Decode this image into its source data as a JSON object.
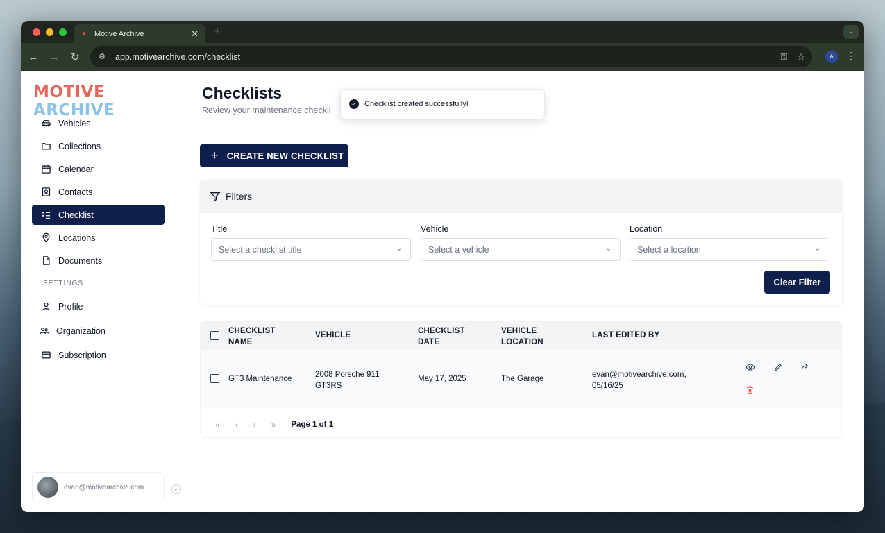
{
  "browser": {
    "tab_title": "Motive Archive",
    "url": "app.motivearchive.com/checklist",
    "profile_initial": "A"
  },
  "sidebar": {
    "logo_part1": "MOTIVE",
    "logo_part2": "ARCHIVE",
    "items": [
      {
        "label": "Vehicles",
        "icon": "car-icon"
      },
      {
        "label": "Collections",
        "icon": "folder-icon"
      },
      {
        "label": "Calendar",
        "icon": "calendar-icon"
      },
      {
        "label": "Contacts",
        "icon": "contact-card-icon"
      },
      {
        "label": "Checklist",
        "icon": "checklist-icon",
        "active": true
      },
      {
        "label": "Locations",
        "icon": "map-pin-icon"
      },
      {
        "label": "Documents",
        "icon": "documents-icon"
      }
    ],
    "settings_label": "SETTINGS",
    "settings_items": [
      {
        "label": "Profile",
        "icon": "user-icon"
      },
      {
        "label": "Organization",
        "icon": "users-icon"
      },
      {
        "label": "Subscription",
        "icon": "credit-card-icon"
      }
    ],
    "user_email": "evan@motivearchive.com"
  },
  "main": {
    "title": "Checklists",
    "subtitle": "Review your maintenance checkli",
    "toast": "Checklist created successfully!",
    "create_button": "CREATE NEW CHECKLIST",
    "filters": {
      "heading": "Filters",
      "title_label": "Title",
      "title_placeholder": "Select a checklist title",
      "vehicle_label": "Vehicle",
      "vehicle_placeholder": "Select a vehicle",
      "location_label": "Location",
      "location_placeholder": "Select a location",
      "clear_button": "Clear Filter"
    },
    "table": {
      "columns": {
        "name_1": "CHECKLIST",
        "name_2": "NAME",
        "vehicle": "VEHICLE",
        "date_1": "CHECKLIST",
        "date_2": "DATE",
        "loc_1": "VEHICLE",
        "loc_2": "LOCATION",
        "edited": "LAST EDITED BY"
      },
      "rows": [
        {
          "name": "GT3 Maintenance",
          "vehicle_1": "2008 Porsche 911",
          "vehicle_2": "GT3RS",
          "date": "May 17, 2025",
          "location": "The Garage",
          "edited_1": "evan@motivearchive.com,",
          "edited_2": "05/16/25"
        }
      ],
      "page_info": "Page 1 of 1"
    }
  },
  "colors": {
    "primary": "#0f1f4b",
    "logo_red": "#e5675b",
    "logo_blue": "#8ec3e6",
    "danger": "#ef4444"
  }
}
